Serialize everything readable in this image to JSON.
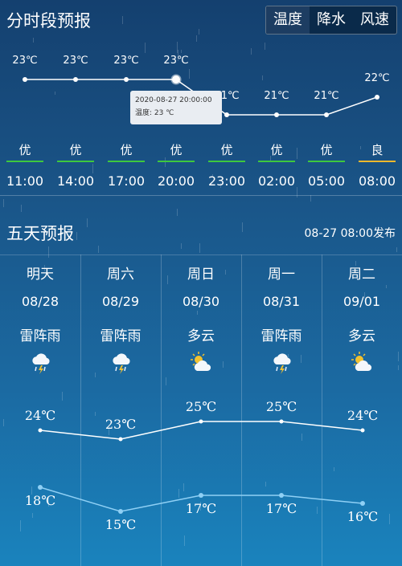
{
  "hourly": {
    "title": "分时段预报",
    "tabs": [
      "温度",
      "降水",
      "风速"
    ],
    "active_tab": 0,
    "temperatures": [
      "23℃",
      "23℃",
      "23℃",
      "23℃",
      "21℃",
      "21℃",
      "21℃",
      "22℃"
    ],
    "aqi": [
      "优",
      "优",
      "优",
      "优",
      "优",
      "优",
      "优",
      "良"
    ],
    "times": [
      "11:00",
      "14:00",
      "17:00",
      "20:00",
      "23:00",
      "02:00",
      "05:00",
      "08:00"
    ],
    "tooltip": {
      "datetime": "2020-08-27 20:00:00",
      "value": "温度: 23 ℃"
    }
  },
  "daily": {
    "title": "五天预报",
    "publish_time": "08-27 08:00发布",
    "days": [
      {
        "week": "明天",
        "date": "08/28",
        "condition": "雷阵雨",
        "icon": "thunderstorm-icon",
        "high": "24℃",
        "low": "18℃"
      },
      {
        "week": "周六",
        "date": "08/29",
        "condition": "雷阵雨",
        "icon": "thunderstorm-icon",
        "high": "23℃",
        "low": "15℃"
      },
      {
        "week": "周日",
        "date": "08/30",
        "condition": "多云",
        "icon": "partly-cloudy-icon",
        "high": "25℃",
        "low": "17℃"
      },
      {
        "week": "周一",
        "date": "08/31",
        "condition": "雷阵雨",
        "icon": "thunderstorm-icon",
        "high": "25℃",
        "low": "17℃"
      },
      {
        "week": "周二",
        "date": "09/01",
        "condition": "多云",
        "icon": "partly-cloudy-icon",
        "high": "24℃",
        "low": "16℃"
      }
    ]
  },
  "colors": {
    "aqi_good": "#3ec83e",
    "aqi_moderate": "#f1b92c",
    "low_line": "#8fd0f5"
  }
}
